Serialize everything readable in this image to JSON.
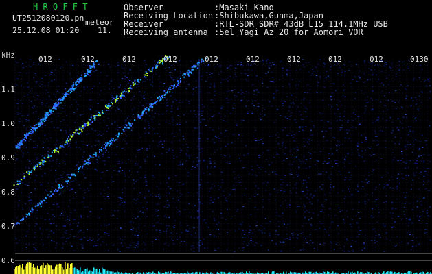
{
  "app": {
    "brand": "H R O F F T",
    "filename": "UT2512080120.pn",
    "meteor_label": "meteor",
    "datetime": "25.12.08 01:20",
    "count": "11."
  },
  "info": [
    {
      "label": "Observer",
      "value": ":Masaki Kano"
    },
    {
      "label": "Receiving Location",
      "value": ":Shibukawa,Gunma,Japan"
    },
    {
      "label": "Receiver",
      "value": ":RTL-SDR SDR# 43dB L15 114.1MHz USB"
    },
    {
      "label": "Receiving antenna",
      "value": ":5el Yagi Az 20 for Aomori VOR"
    }
  ],
  "axis": {
    "unit": "kHz",
    "y_ticks": [
      "1.1",
      "1.0",
      "0.9",
      "0.8",
      "0.7",
      "0.6"
    ],
    "x_ticks": [
      "012",
      "012",
      "012",
      "012",
      "012",
      "012",
      "012",
      "012",
      "012",
      "0130"
    ]
  },
  "colors": {
    "background": "#000000",
    "noise": "#1030b0",
    "grid": "#2a2a7a",
    "trace": "#20a8ff",
    "trace_hot": "#b0ff30",
    "bars_yellow": "#ffff30",
    "bars_cyan": "#20e8ff"
  }
}
